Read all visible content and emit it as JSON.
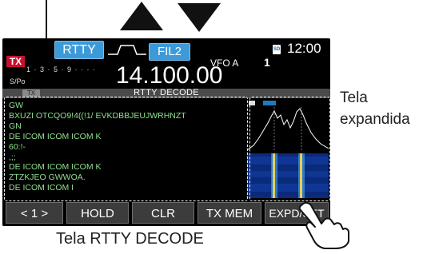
{
  "header": {
    "tx_label": "TX",
    "mode": "RTTY",
    "filter": "FIL2",
    "vfo_label": "VFO A",
    "vfo_number": "1",
    "sd_icon": "sd-card-icon",
    "clock": "12:00"
  },
  "meter": {
    "scale": "1 · 3 · 5 · 9 · · · ·",
    "label": "S/Po"
  },
  "frequency": "14.100.00",
  "decode": {
    "tx_small": "TX",
    "title": "RTTY DECODE",
    "lines": [
      "GW",
      "BXUZI OTCQO9!4((!1/ EVKDBBJEUJWRHNZT",
      "GN",
      "DE ICOM ICOM ICOM K",
      "60:!-",
      ",;;",
      "DE ICOM ICOM ICOM K",
      "ZTZKJEO GWWOA.",
      "DE ICOM ICOM I"
    ]
  },
  "buttons": [
    "< 1 >",
    "HOLD",
    "CLR",
    "TX MEM",
    "EXPD/SET"
  ],
  "captions": {
    "right_line1": "Tela",
    "right_line2": "expandida",
    "bottom": "Tela RTTY DECODE"
  },
  "colors": {
    "screen_bg": "#000000",
    "accent_blue": "#3c9ad8",
    "tx_red": "#c8102e",
    "decode_text": "#8fe08f",
    "waterfall_bg": "#001846"
  }
}
